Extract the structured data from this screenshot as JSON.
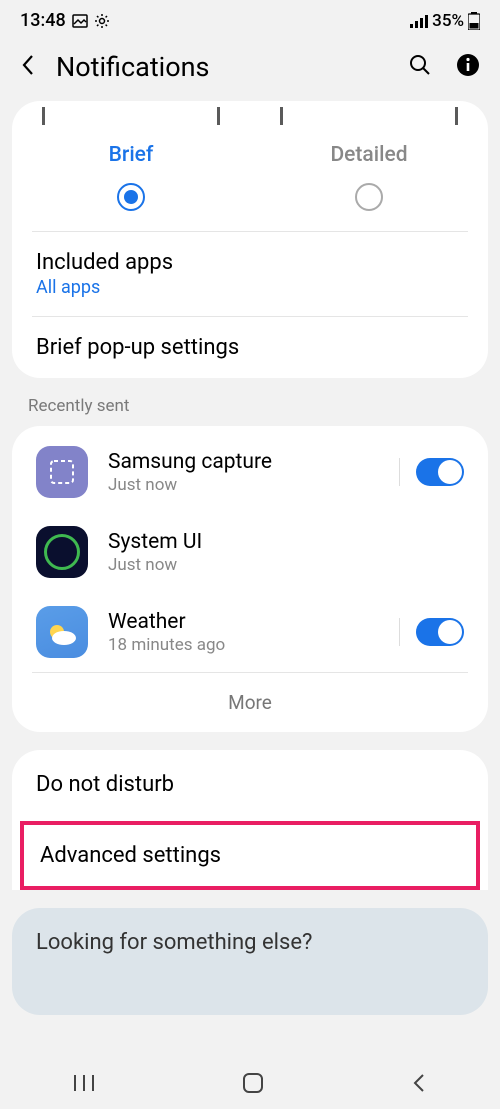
{
  "status": {
    "time": "13:48",
    "battery_text": "35%"
  },
  "header": {
    "title": "Notifications"
  },
  "styles": {
    "brief": "Brief",
    "detailed": "Detailed"
  },
  "included": {
    "title": "Included apps",
    "value": "All apps"
  },
  "brief_popup": "Brief pop-up settings",
  "recent": {
    "label": "Recently sent",
    "apps": [
      {
        "name": "Samsung capture",
        "time": "Just now",
        "toggle": true
      },
      {
        "name": "System UI",
        "time": "Just now",
        "toggle": false
      },
      {
        "name": "Weather",
        "time": "18 minutes ago",
        "toggle": true
      }
    ],
    "more": "More"
  },
  "settings": {
    "dnd": "Do not disturb",
    "advanced": "Advanced settings"
  },
  "looking": "Looking for something else?"
}
